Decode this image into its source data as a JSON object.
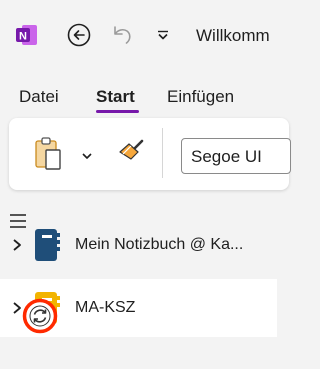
{
  "titlebar": {
    "app_logo": "onenote-icon",
    "back_icon": "back-arrow-icon",
    "undo_icon": "undo-icon",
    "qat_icon": "chevron-down-icon",
    "window_title": "Willkomm"
  },
  "ribbon": {
    "tabs": [
      {
        "label": "Datei"
      },
      {
        "label": "Start",
        "selected": true
      },
      {
        "label": "Einfügen"
      },
      {
        "label": ""
      }
    ],
    "paste_icon": "clipboard-paste-icon",
    "format_painter_icon": "format-painter-icon",
    "font_name": "Segoe UI"
  },
  "navigation": {
    "menu_icon": "hamburger-icon",
    "notebooks": [
      {
        "label": "Mein Notizbuch @ Ka...",
        "icon": "notebook-icon",
        "color": "#1f4e79"
      },
      {
        "label": "MA-KSZ",
        "icon": "notebook-icon",
        "color": "#f2b400",
        "status": "sync-icon"
      }
    ]
  },
  "colors": {
    "accent": "#7719aa",
    "sync_highlight": "#ff2a00"
  }
}
